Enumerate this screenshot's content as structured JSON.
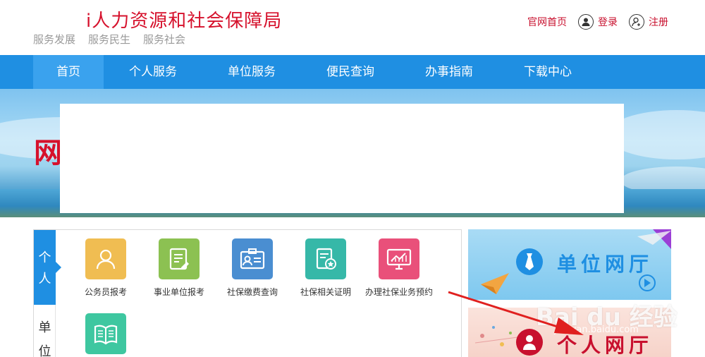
{
  "header": {
    "site_title": "i人力资源和社会保障局",
    "slogans": [
      "服务发展",
      "服务民生",
      "服务社会"
    ],
    "links": {
      "home": "官网首页",
      "login": "登录",
      "register": "注册"
    }
  },
  "nav": {
    "items": [
      "首页",
      "个人服务",
      "单位服务",
      "便民查询",
      "办事指南",
      "下载中心"
    ],
    "active_index": 0
  },
  "banner": {
    "partial_text": "网"
  },
  "service_box": {
    "tabs": {
      "personal": [
        "个",
        "人"
      ],
      "unit": [
        "单",
        "位"
      ]
    },
    "services": [
      {
        "label": "公务员报考",
        "icon": "person-icon",
        "color": "#f0bd52"
      },
      {
        "label": "事业单位报考",
        "icon": "document-edit-icon",
        "color": "#8cc152"
      },
      {
        "label": "社保缴费查询",
        "icon": "id-card-icon",
        "color": "#4a8ed1"
      },
      {
        "label": "社保相关证明",
        "icon": "certificate-icon",
        "color": "#36b8a8"
      },
      {
        "label": "办理社保业务预约",
        "icon": "monitor-chart-icon",
        "color": "#e9507a"
      },
      {
        "label": "",
        "icon": "book-icon",
        "color": "#3ec7a0"
      }
    ]
  },
  "right_panels": {
    "unit": {
      "title": "单位网厅",
      "color": "#1f8fe2"
    },
    "personal": {
      "title": "个人网厅",
      "color": "#c8102e"
    }
  },
  "watermark": {
    "main": "Bai du 经验",
    "sub": "jingyan.baidu.com"
  }
}
